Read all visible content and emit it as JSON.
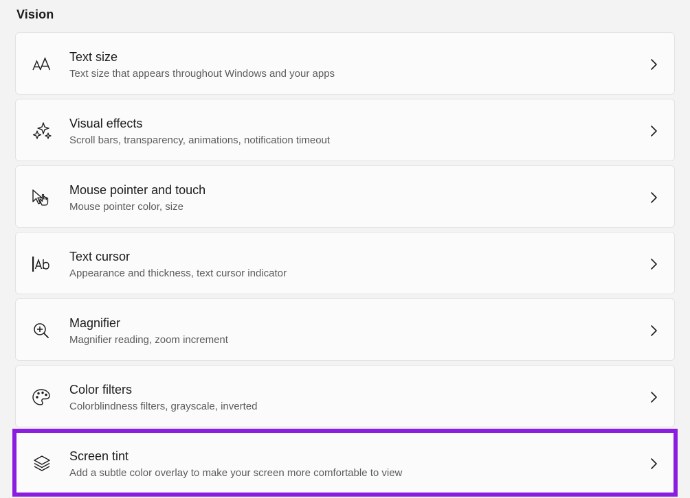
{
  "section": {
    "title": "Vision"
  },
  "items": [
    {
      "title": "Text size",
      "subtitle": "Text size that appears throughout Windows and your apps",
      "icon": "text-size-icon",
      "icon_text": "AA"
    },
    {
      "title": "Visual effects",
      "subtitle": "Scroll bars, transparency, animations, notification timeout",
      "icon": "sparkle-icon"
    },
    {
      "title": "Mouse pointer and touch",
      "subtitle": "Mouse pointer color, size",
      "icon": "mouse-pointer-touch-icon"
    },
    {
      "title": "Text cursor",
      "subtitle": "Appearance and thickness, text cursor indicator",
      "icon": "text-cursor-icon",
      "icon_text": "Ab"
    },
    {
      "title": "Magnifier",
      "subtitle": "Magnifier reading, zoom increment",
      "icon": "magnifier-icon"
    },
    {
      "title": "Color filters",
      "subtitle": "Colorblindness filters, grayscale, inverted",
      "icon": "palette-icon"
    },
    {
      "title": "Screen tint",
      "subtitle": "Add a subtle color overlay to make your screen more comfortable to view",
      "icon": "layers-icon",
      "highlighted": true
    }
  ],
  "colors": {
    "highlight_border": "#8a1de0",
    "card_background": "#fbfbfb",
    "page_background": "#f3f3f3"
  }
}
